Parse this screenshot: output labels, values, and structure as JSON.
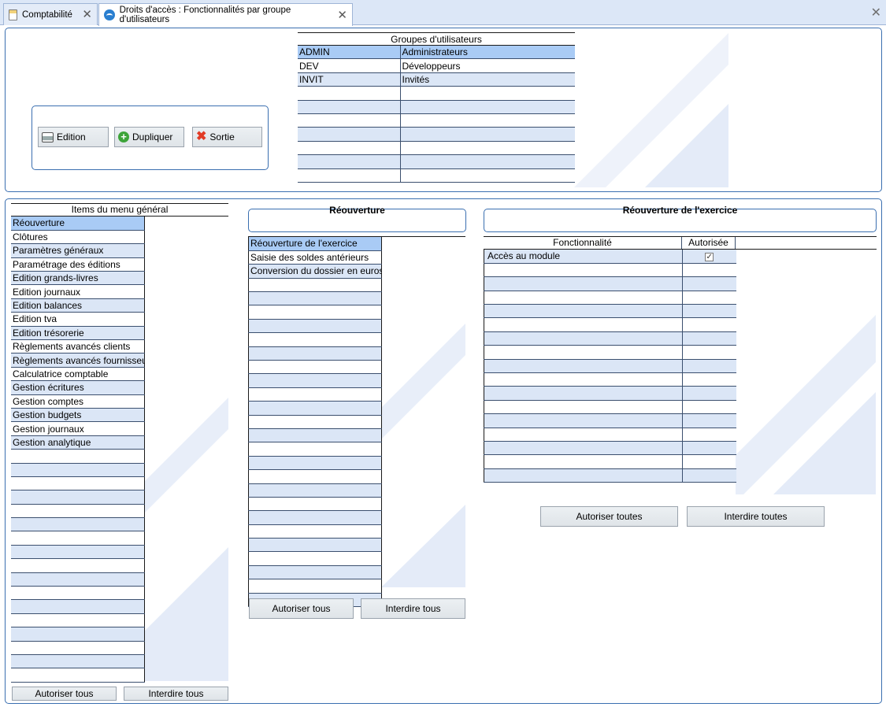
{
  "tabs": [
    {
      "label": "Comptabilité",
      "icon": "calculator-icon",
      "active": false
    },
    {
      "label": "Droits d'accès : Fonctionnalités par groupe d'utilisateurs",
      "icon": "app-icon",
      "active": true
    }
  ],
  "toolbar": {
    "edition_label": "Edition",
    "dupliquer_label": "Dupliquer",
    "sortie_label": "Sortie"
  },
  "groups": {
    "header": "Groupes d'utilisateurs",
    "rows": [
      {
        "code": "ADMIN",
        "name": "Administrateurs",
        "selected": true
      },
      {
        "code": "DEV",
        "name": "Développeurs"
      },
      {
        "code": "INVIT",
        "name": "Invités"
      },
      {
        "code": "",
        "name": ""
      },
      {
        "code": "",
        "name": ""
      },
      {
        "code": "",
        "name": ""
      },
      {
        "code": "",
        "name": ""
      },
      {
        "code": "",
        "name": ""
      },
      {
        "code": "",
        "name": ""
      },
      {
        "code": "",
        "name": ""
      }
    ]
  },
  "menu": {
    "header": "Items du menu général",
    "items": [
      "Réouverture",
      "Clôtures",
      "Paramètres généraux",
      "Paramétrage des éditions",
      "Edition grands-livres",
      "Edition journaux",
      "Edition balances",
      "Edition tva",
      "Edition trésorerie",
      "Règlements avancés clients",
      "Règlements avancés fournisseurs",
      "Calculatrice comptable",
      "Gestion écritures",
      "Gestion comptes",
      "Gestion budgets",
      "Gestion journaux",
      "Gestion analytique",
      "",
      "",
      "",
      "",
      "",
      "",
      "",
      "",
      "",
      "",
      "",
      "",
      "",
      "",
      "",
      "",
      ""
    ],
    "authorize_all": "Autoriser tous",
    "forbid_all": "Interdire tous"
  },
  "submenu": {
    "title": "Réouverture",
    "items": [
      "Réouverture de l'exercice",
      "Saisie des soldes antérieurs",
      "Conversion du dossier en euros",
      "",
      "",
      "",
      "",
      "",
      "",
      "",
      "",
      "",
      "",
      "",
      "",
      "",
      "",
      "",
      "",
      "",
      "",
      "",
      "",
      "",
      "",
      "",
      ""
    ],
    "authorize_all": "Autoriser tous",
    "forbid_all": "Interdire tous"
  },
  "features": {
    "title": "Réouverture de l'exercice",
    "col_function": "Fonctionnalité",
    "col_authorized": "Autorisée",
    "rows": [
      {
        "name": "Accès au module",
        "checked": true
      },
      {
        "name": ""
      },
      {
        "name": ""
      },
      {
        "name": ""
      },
      {
        "name": ""
      },
      {
        "name": ""
      },
      {
        "name": ""
      },
      {
        "name": ""
      },
      {
        "name": ""
      },
      {
        "name": ""
      },
      {
        "name": ""
      },
      {
        "name": ""
      },
      {
        "name": ""
      },
      {
        "name": ""
      },
      {
        "name": ""
      },
      {
        "name": ""
      },
      {
        "name": ""
      }
    ],
    "authorize_all": "Autoriser toutes",
    "forbid_all": "Interdire toutes"
  },
  "colors": {
    "tabbar": "#dce7f7",
    "panel_border": "#3a6fb0",
    "row_alt": "#dbe6f6",
    "row_selected": "#a9cbf5"
  }
}
